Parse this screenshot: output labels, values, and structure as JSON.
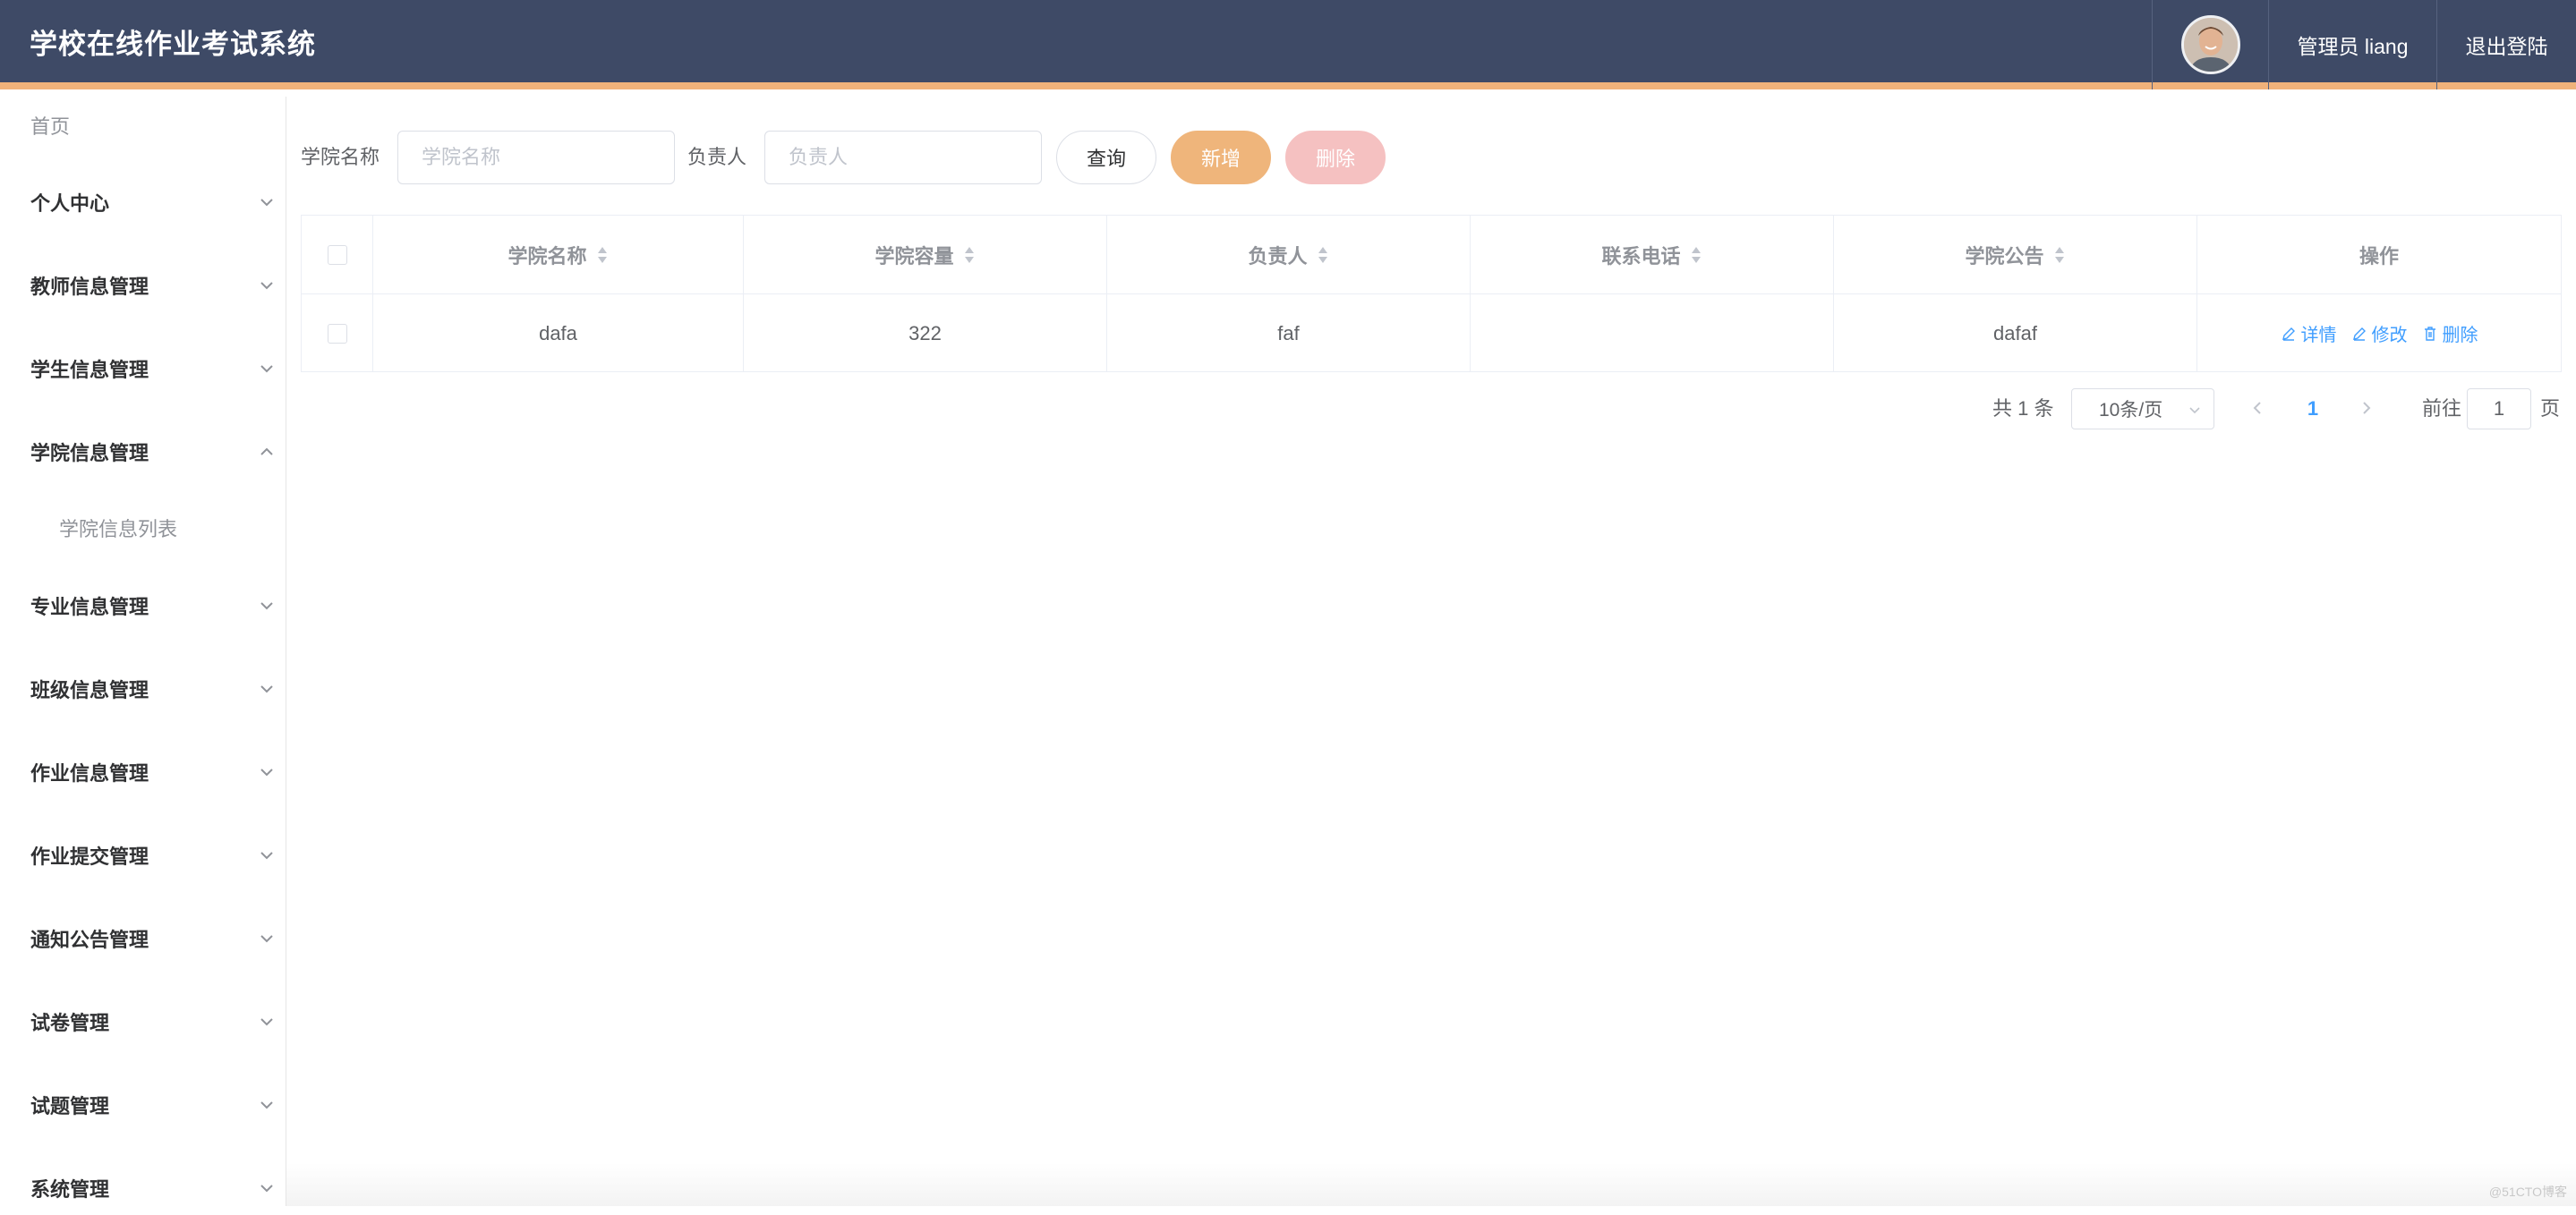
{
  "header": {
    "title": "学校在线作业考试系统",
    "user_label": "管理员 liang",
    "logout_label": "退出登陆"
  },
  "sidebar": {
    "home": "首页",
    "items": [
      {
        "label": "个人中心"
      },
      {
        "label": "教师信息管理"
      },
      {
        "label": "学生信息管理"
      },
      {
        "label": "学院信息管理"
      },
      {
        "label": "学院信息列表"
      },
      {
        "label": "专业信息管理"
      },
      {
        "label": "班级信息管理"
      },
      {
        "label": "作业信息管理"
      },
      {
        "label": "作业提交管理"
      },
      {
        "label": "通知公告管理"
      },
      {
        "label": "试卷管理"
      },
      {
        "label": "试题管理"
      },
      {
        "label": "系统管理"
      }
    ]
  },
  "search": {
    "college_name_label": "学院名称",
    "college_name_placeholder": "学院名称",
    "leader_label": "负责人",
    "leader_placeholder": "负责人",
    "query_label": "查询",
    "add_label": "新增",
    "delete_label": "删除"
  },
  "table": {
    "columns": [
      "学院名称",
      "学院容量",
      "负责人",
      "联系电话",
      "学院公告",
      "操作"
    ],
    "rows": [
      {
        "name": "dafa",
        "capacity": "322",
        "leader": "faf",
        "phone": "",
        "notice": "dafaf"
      }
    ],
    "actions": {
      "detail": "详情",
      "edit": "修改",
      "delete": "删除"
    }
  },
  "pagination": {
    "total": "共 1 条",
    "page_size": "10条/页",
    "current_page": "1",
    "goto_label": "前往",
    "goto_value": "1",
    "page_suffix": "页"
  },
  "watermark": "@51CTO博客",
  "colors": {
    "header_bg": "#3e4a66",
    "header_accent": "#f0b27a",
    "add_button": "#efb57b",
    "delete_button": "#f5c1c1",
    "link": "#409eff"
  }
}
